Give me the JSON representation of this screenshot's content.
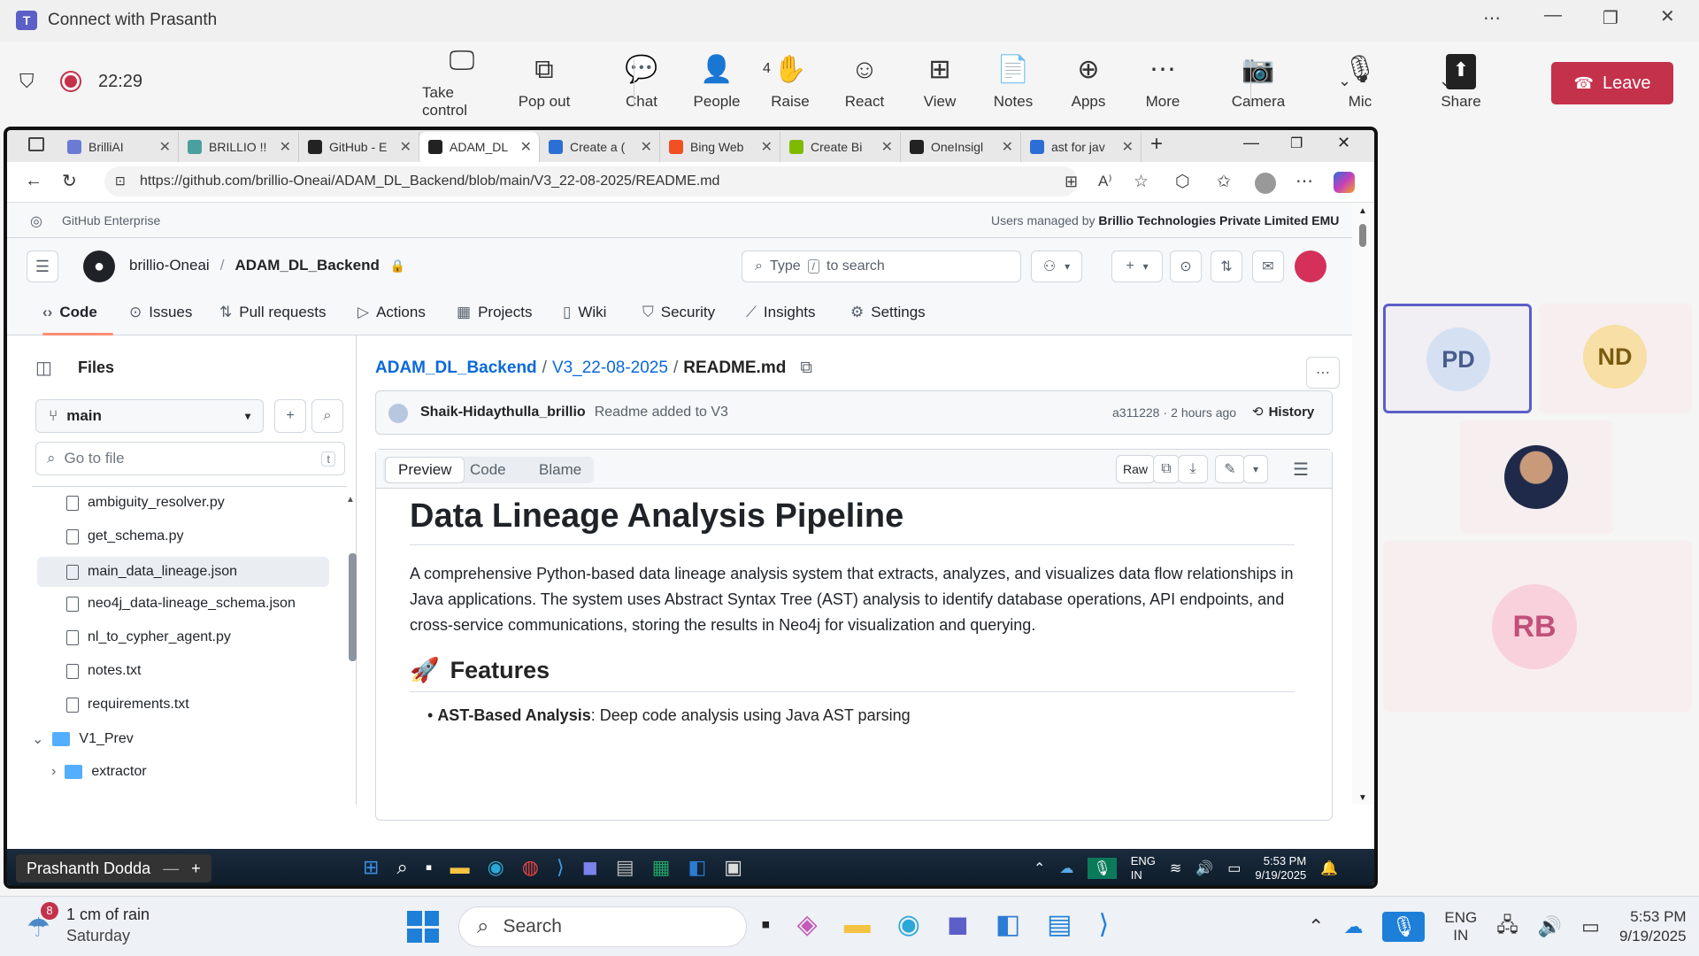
{
  "teams": {
    "title": "Connect with Prasanth",
    "timer": "22:29",
    "toolbar": [
      {
        "label": "Take control",
        "icon": "take-control-icon",
        "glyph": "🖵"
      },
      {
        "label": "Pop out",
        "icon": "pop-out-icon",
        "glyph": "⧉"
      },
      {
        "label": "Chat",
        "icon": "chat-icon",
        "glyph": "💬"
      },
      {
        "label": "People",
        "icon": "people-icon",
        "glyph": "👤"
      },
      {
        "label": "Raise",
        "icon": "raise-hand-icon",
        "glyph": "✋"
      },
      {
        "label": "React",
        "icon": "react-icon",
        "glyph": "☺"
      },
      {
        "label": "View",
        "icon": "view-icon",
        "glyph": "⊞"
      },
      {
        "label": "Notes",
        "icon": "notes-icon",
        "glyph": "📄"
      },
      {
        "label": "Apps",
        "icon": "apps-icon",
        "glyph": "⊕"
      },
      {
        "label": "More",
        "icon": "more-icon",
        "glyph": "⋯"
      },
      {
        "label": "Camera",
        "icon": "camera-off-icon",
        "glyph": "📷"
      },
      {
        "label": "Mic",
        "icon": "mic-icon",
        "glyph": "🎙"
      },
      {
        "label": "Share",
        "icon": "share-icon",
        "glyph": "⬆"
      }
    ],
    "people_count": "4",
    "leave_label": "Leave",
    "participants": [
      {
        "initials": "PD",
        "color": "#4a5b8c"
      },
      {
        "initials": "ND",
        "color": "#7a5a10"
      },
      {
        "initials": "RB",
        "color": "#c0507a"
      }
    ]
  },
  "browser": {
    "tabs": [
      {
        "title": "BrilliAI",
        "color": "#6b7bd4"
      },
      {
        "title": "BRILLIO !!",
        "color": "#4aa0a0"
      },
      {
        "title": "GitHub - E",
        "color": "#222"
      },
      {
        "title": "ADAM_DL",
        "color": "#222",
        "active": true
      },
      {
        "title": "Create a (",
        "color": "#2b6fd4"
      },
      {
        "title": "Bing Web",
        "color": "#f25022"
      },
      {
        "title": "Create Bi",
        "color": "#7fba00"
      },
      {
        "title": "OneInsigl",
        "color": "#222"
      },
      {
        "title": "ast for jav",
        "color": "#2b6fd4"
      }
    ],
    "url": "https://github.com/brillio-Oneai/ADAM_DL_Backend/blob/main/V3_22-08-2025/README.md"
  },
  "github": {
    "enterprise_label": "GitHub Enterprise",
    "managed_prefix": "Users managed by",
    "managed_org": "Brillio Technologies Private Limited EMU",
    "owner": "brillio-Oneai",
    "repo": "ADAM_DL_Backend",
    "search_prefix": "Type",
    "search_key": "/",
    "search_suffix": "to search",
    "nav": [
      "Code",
      "Issues",
      "Pull requests",
      "Actions",
      "Projects",
      "Wiki",
      "Security",
      "Insights",
      "Settings"
    ],
    "files_title": "Files",
    "branch": "main",
    "goto_placeholder": "Go to file",
    "goto_key": "t",
    "tree": [
      {
        "name": "ambiguity_resolver.py",
        "type": "file"
      },
      {
        "name": "get_schema.py",
        "type": "file"
      },
      {
        "name": "main_data_lineage.json",
        "type": "file",
        "hover": true
      },
      {
        "name": "neo4j_data-lineage_schema.json",
        "type": "file"
      },
      {
        "name": "nl_to_cypher_agent.py",
        "type": "file"
      },
      {
        "name": "notes.txt",
        "type": "file"
      },
      {
        "name": "requirements.txt",
        "type": "file"
      },
      {
        "name": "V1_Prev",
        "type": "folder-open"
      },
      {
        "name": "extractor",
        "type": "folder"
      }
    ],
    "breadcrumb": {
      "repo": "ADAM_DL_Backend",
      "folder": "V3_22-08-2025",
      "file": "README.md"
    },
    "commit": {
      "author": "Shaik-Hidaythulla_brillio",
      "message": "Readme added to V3",
      "sha": "a311228",
      "time": "2 hours ago",
      "history": "History"
    },
    "view_tabs": [
      "Preview",
      "Code",
      "Blame"
    ],
    "raw_label": "Raw",
    "readme": {
      "h1": "Data Lineage Analysis Pipeline",
      "p1": "A comprehensive Python-based data lineage analysis system that extracts, analyzes, and visualizes data flow relationships in Java applications. The system uses Abstract Syntax Tree (AST) analysis to identify database operations, API endpoints, and cross-service communications, storing the results in Neo4j for visualization and querying.",
      "h2": "Features",
      "h2_emoji": "🚀",
      "bullet_bold": "AST-Based Analysis",
      "bullet_text": ": Deep code analysis using Java AST parsing"
    }
  },
  "inner_taskbar": {
    "presenter": "Prashanth Dodda",
    "lang": "ENG",
    "region": "IN",
    "time": "5:53 PM",
    "date": "9/19/2025"
  },
  "win_taskbar": {
    "weather_text": "1 cm of rain",
    "weather_day": "Saturday",
    "weather_badge": "8",
    "search_label": "Search",
    "lang": "ENG",
    "region": "IN",
    "time": "5:53 PM",
    "date": "9/19/2025"
  }
}
